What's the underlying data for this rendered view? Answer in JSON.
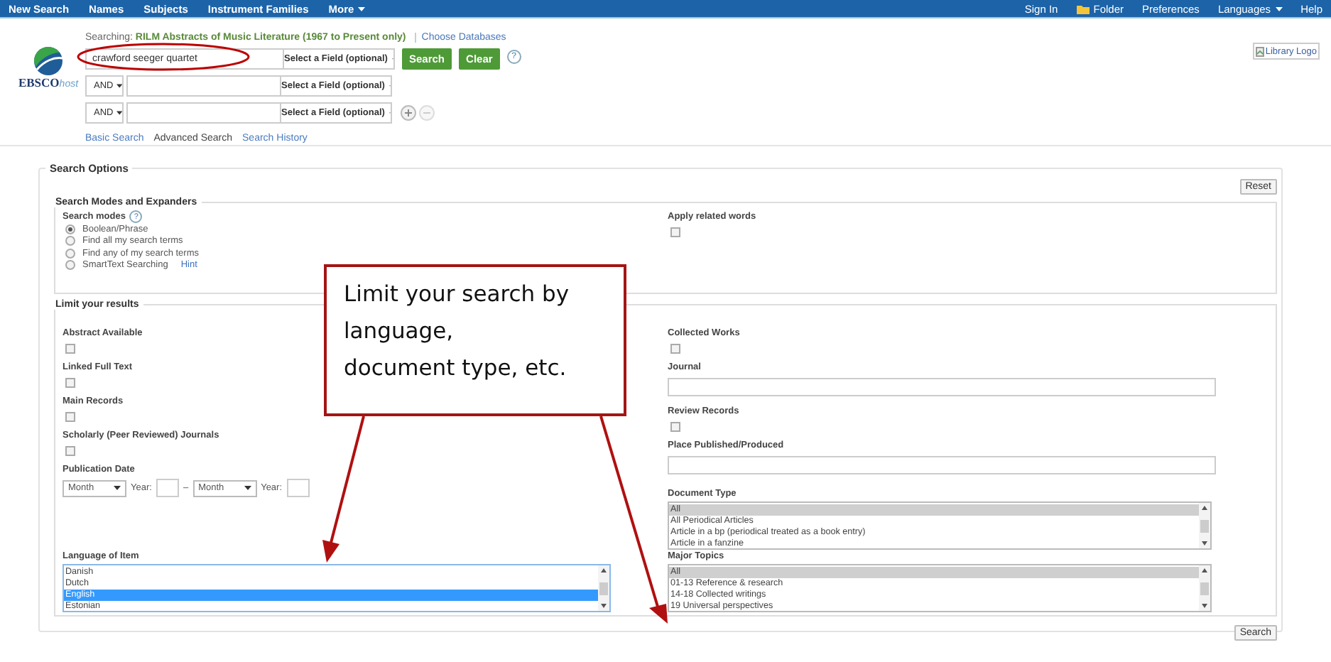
{
  "top_nav": {
    "left": [
      {
        "label": "New Search",
        "kind": "link"
      },
      {
        "label": "Names",
        "kind": "link"
      },
      {
        "label": "Subjects",
        "kind": "link"
      },
      {
        "label": "Instrument Families",
        "kind": "link"
      },
      {
        "label": "More",
        "kind": "menu"
      }
    ],
    "right": [
      {
        "label": "Sign In",
        "kind": "link"
      },
      {
        "label": "Folder",
        "kind": "folder"
      },
      {
        "label": "Preferences",
        "kind": "link"
      },
      {
        "label": "Languages",
        "kind": "menu"
      },
      {
        "label": "Help",
        "kind": "link"
      }
    ]
  },
  "header": {
    "logo_text": "EBSCO",
    "logo_suffix": "host",
    "library_logo": "Library Logo",
    "searching_label": "Searching:",
    "database": "RILM Abstracts of Music Literature (1967 to Present only)",
    "choose_databases": "Choose Databases",
    "rows": [
      {
        "value": "crawford seeger quartet",
        "field": "Select a Field (optional)"
      },
      {
        "operator": "AND",
        "field": "Select a Field (optional)"
      },
      {
        "operator": "AND",
        "field": "Select a Field (optional)"
      }
    ],
    "search_button": "Search",
    "clear_button": "Clear",
    "help": "?",
    "links": [
      {
        "label": "Basic Search",
        "selected": false
      },
      {
        "label": "Advanced Search",
        "selected": true
      },
      {
        "label": "Search History",
        "selected": false
      }
    ]
  },
  "search_options": {
    "title": "Search Options",
    "reset": "Reset",
    "modes": {
      "title": "Search Modes and Expanders",
      "label": "Search modes",
      "help": "?",
      "options": [
        {
          "label": "Boolean/Phrase",
          "selected": true
        },
        {
          "label": "Find all my search terms",
          "selected": false
        },
        {
          "label": "Find any of my search terms",
          "selected": false
        },
        {
          "label": "SmartText Searching",
          "selected": false,
          "link": "Hint"
        }
      ],
      "expanders": [
        {
          "label": "Apply related words",
          "checked": false
        }
      ]
    },
    "limits": {
      "title": "Limit your results",
      "left": [
        {
          "kind": "checkbox",
          "label": "Abstract Available",
          "checked": false
        },
        {
          "kind": "checkbox",
          "label": "Linked Full Text",
          "checked": false
        },
        {
          "kind": "checkbox",
          "label": "Main Records",
          "checked": false
        },
        {
          "kind": "checkbox",
          "label": "Scholarly (Peer Reviewed) Journals",
          "checked": false
        },
        {
          "kind": "date",
          "label": "Publication Date",
          "from_month": "Month",
          "from_year_label": "Year:",
          "separator": "–",
          "to_month": "Month",
          "to_year_label": "Year:"
        },
        {
          "kind": "listbox",
          "label": "Language of Item",
          "focused": true,
          "options": [
            {
              "label": "Danish",
              "selected": false
            },
            {
              "label": "Dutch",
              "selected": false
            },
            {
              "label": "English",
              "selected": true
            },
            {
              "label": "Estonian",
              "selected": false
            }
          ]
        }
      ],
      "right": [
        {
          "kind": "checkbox",
          "label": "Collected Works",
          "checked": false
        },
        {
          "kind": "text",
          "label": "Journal"
        },
        {
          "kind": "checkbox",
          "label": "Review Records",
          "checked": false
        },
        {
          "kind": "text",
          "label": "Place Published/Produced"
        },
        {
          "kind": "listbox",
          "label": "Document Type",
          "focused": false,
          "options": [
            {
              "label": "All",
              "selected": true
            },
            {
              "label": "All Periodical Articles",
              "selected": false
            },
            {
              "label": "Article in a bp (periodical treated as a book entry)",
              "selected": false
            },
            {
              "label": "Article in a fanzine",
              "selected": false
            }
          ]
        },
        {
          "kind": "listbox",
          "label": "Major Topics",
          "focused": false,
          "options": [
            {
              "label": "All",
              "selected": true
            },
            {
              "label": "01-13 Reference & research",
              "selected": false
            },
            {
              "label": "14-18 Collected writings",
              "selected": false
            },
            {
              "label": "19 Universal perspectives",
              "selected": false
            }
          ]
        }
      ]
    },
    "search_button": "Search"
  },
  "annotations": {
    "callout": "Limit your search by\nlanguage,\ndocument type, etc."
  }
}
